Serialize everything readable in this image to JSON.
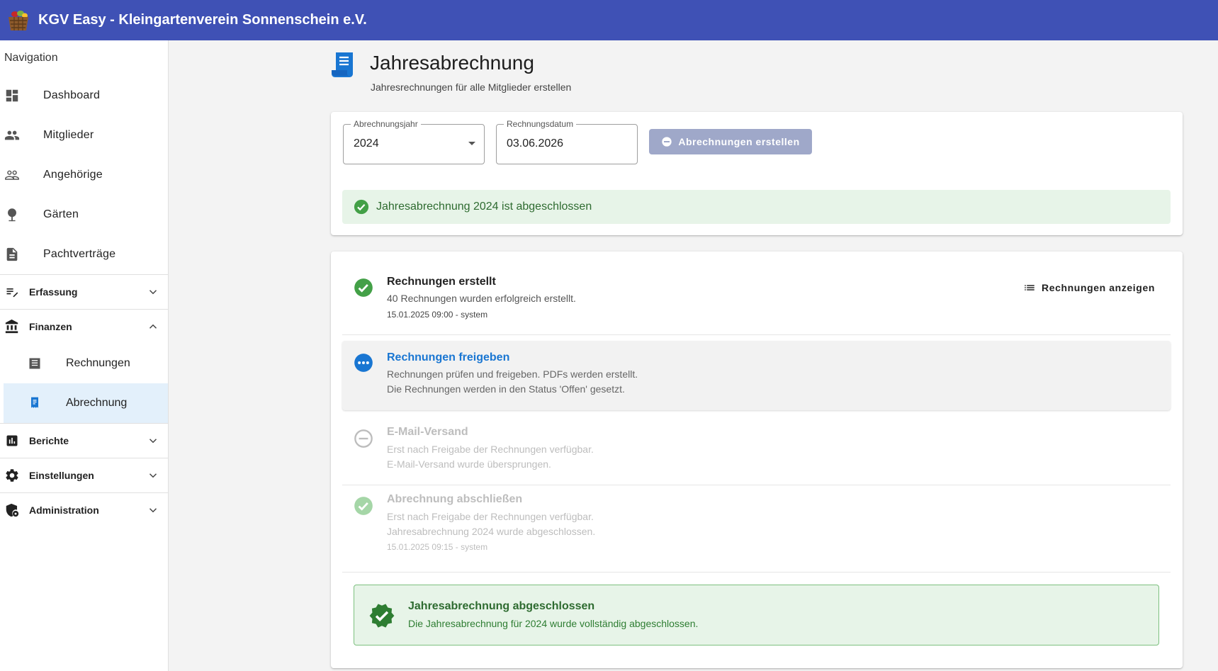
{
  "app": {
    "title": "KGV Easy - Kleingartenverein Sonnenschein e.V."
  },
  "sidebar": {
    "header": "Navigation",
    "items": [
      {
        "label": "Dashboard",
        "icon": "dashboard-icon"
      },
      {
        "label": "Mitglieder",
        "icon": "people-icon"
      },
      {
        "label": "Angehörige",
        "icon": "people-outline-icon"
      },
      {
        "label": "Gärten",
        "icon": "tree-icon"
      },
      {
        "label": "Pachtverträge",
        "icon": "document-icon"
      }
    ],
    "groups": {
      "erfassung": {
        "label": "Erfassung",
        "expanded": false
      },
      "finanzen": {
        "label": "Finanzen",
        "expanded": true
      },
      "berichte": {
        "label": "Berichte",
        "expanded": false
      },
      "einstellungen": {
        "label": "Einstellungen",
        "expanded": false
      },
      "administration": {
        "label": "Administration",
        "expanded": false
      }
    },
    "finanzen_items": [
      {
        "label": "Rechnungen",
        "active": false
      },
      {
        "label": "Abrechnung",
        "active": true
      }
    ]
  },
  "page": {
    "title": "Jahresabrechnung",
    "subtitle": "Jahresrechnungen für alle Mitglieder erstellen"
  },
  "form": {
    "year_label": "Abrechnungsjahr",
    "year_value": "2024",
    "date_label": "Rechnungsdatum",
    "date_value": "03.06.2026",
    "create_button": "Abrechnungen erstellen"
  },
  "status_alert": "Jahresabrechnung 2024 ist abgeschlossen",
  "steps": [
    {
      "title": "Rechnungen erstellt",
      "line1": "40 Rechnungen wurden erfolgreich erstellt.",
      "meta": "15.01.2025 09:00 - system",
      "action": "Rechnungen anzeigen",
      "state": "done"
    },
    {
      "title": "Rechnungen freigeben",
      "line1": "Rechnungen prüfen und freigeben. PDFs werden erstellt.",
      "line2": "Die Rechnungen werden in den Status 'Offen' gesetzt.",
      "state": "active"
    },
    {
      "title": "E-Mail-Versand",
      "line1": "Erst nach Freigabe der Rechnungen verfügbar.",
      "line2": "E-Mail-Versand wurde übersprungen.",
      "state": "skipped"
    },
    {
      "title": "Abrechnung abschließen",
      "line1": "Erst nach Freigabe der Rechnungen verfügbar.",
      "line2": "Jahresabrechnung 2024 wurde abgeschlossen.",
      "meta": "15.01.2025 09:15 - system",
      "state": "done-disabled"
    }
  ],
  "final": {
    "title": "Jahresabrechnung abgeschlossen",
    "text": "Die Jahresabrechnung für 2024 wurde vollständig abgeschlossen."
  },
  "colors": {
    "appbar": "#3f51b5",
    "success": "#43a047",
    "active_blue": "#1976d2",
    "disabled": "#bdbdbd"
  }
}
